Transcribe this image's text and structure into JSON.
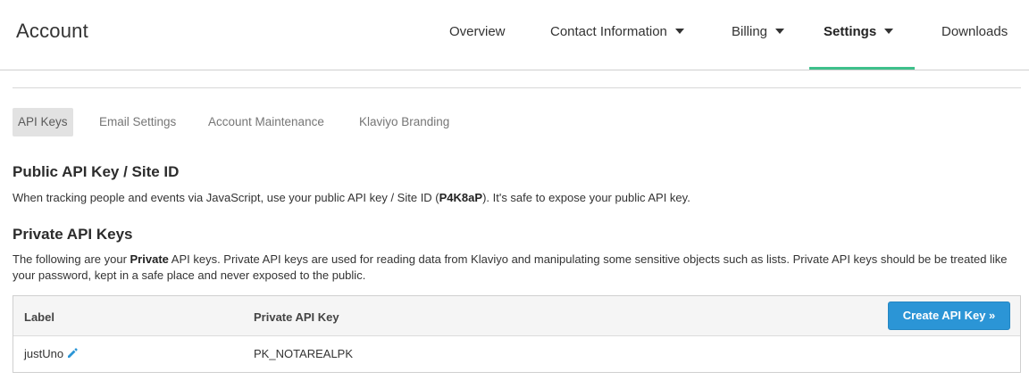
{
  "header": {
    "title": "Account",
    "nav": [
      {
        "label": "Overview",
        "dropdown": false,
        "active": false
      },
      {
        "label": "Contact Information",
        "dropdown": true,
        "active": false
      },
      {
        "label": "Billing",
        "dropdown": true,
        "active": false
      },
      {
        "label": "Settings",
        "dropdown": true,
        "active": true
      },
      {
        "label": "Downloads",
        "dropdown": false,
        "active": false
      }
    ],
    "active_color": "#3ec08b"
  },
  "subtabs": [
    {
      "label": "API Keys",
      "active": true
    },
    {
      "label": "Email Settings",
      "active": false
    },
    {
      "label": "Account Maintenance",
      "active": false
    },
    {
      "label": "Klaviyo Branding",
      "active": false
    }
  ],
  "public_key": {
    "heading": "Public API Key / Site ID",
    "text_before": "When tracking people and events via JavaScript, use your public API key / Site ID (",
    "site_id": "P4K8aP",
    "text_after": "). It's safe to expose your public API key."
  },
  "private_keys": {
    "heading": "Private API Keys",
    "text_before": "The following are your ",
    "emphasis": "Private",
    "text_after": " API keys. Private API keys are used for reading data from Klaviyo and manipulating some sensitive objects such as lists. Private API keys should be be treated like your password, kept in a safe place and never exposed to the public.",
    "table": {
      "columns": [
        "Label",
        "Private API Key"
      ],
      "create_button": "Create API Key »",
      "rows": [
        {
          "label": "justUno",
          "key": "PK_NOTAREALPK",
          "edit_icon": "pencil-icon"
        }
      ]
    }
  },
  "colors": {
    "button": "#2b95d6",
    "edit_icon": "#2b95d6"
  }
}
